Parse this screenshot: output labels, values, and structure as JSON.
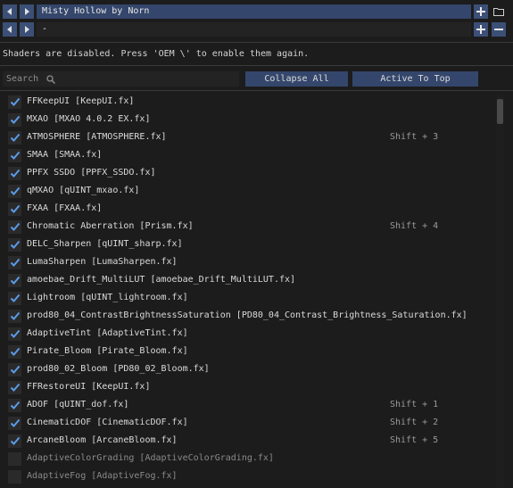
{
  "preset": {
    "name": "Misty Hollow by Norn"
  },
  "second": {
    "value": "-"
  },
  "message": "Shaders are disabled. Press 'OEM \\' to enable them again.",
  "search": {
    "placeholder": "Search"
  },
  "buttons": {
    "collapse": "Collapse All",
    "active_top": "Active To Top"
  },
  "icons": {
    "prev": "chevron-left-icon",
    "next": "chevron-right-icon",
    "add": "plus-icon",
    "folder": "folder-icon",
    "remove": "minus-icon",
    "search": "search-icon",
    "check": "checkmark-icon"
  },
  "colors": {
    "accent": "#3b4f77",
    "check": "#5b9be8",
    "background": "#1c1c1c"
  },
  "effects": [
    {
      "name": "FFKeepUI [KeepUI.fx]",
      "hotkey": "",
      "enabled": true
    },
    {
      "name": "MXAO [MXAO 4.0.2 EX.fx]",
      "hotkey": "",
      "enabled": true
    },
    {
      "name": "ATMOSPHERE [ATMOSPHERE.fx]",
      "hotkey": "Shift + 3",
      "enabled": true
    },
    {
      "name": "SMAA [SMAA.fx]",
      "hotkey": "",
      "enabled": true
    },
    {
      "name": "PPFX SSDO [PPFX_SSDO.fx]",
      "hotkey": "",
      "enabled": true
    },
    {
      "name": "qMXAO [qUINT_mxao.fx]",
      "hotkey": "",
      "enabled": true
    },
    {
      "name": "FXAA [FXAA.fx]",
      "hotkey": "",
      "enabled": true
    },
    {
      "name": "Chromatic Aberration [Prism.fx]",
      "hotkey": "Shift + 4",
      "enabled": true
    },
    {
      "name": "DELC_Sharpen [qUINT_sharp.fx]",
      "hotkey": "",
      "enabled": true
    },
    {
      "name": "LumaSharpen [LumaSharpen.fx]",
      "hotkey": "",
      "enabled": true
    },
    {
      "name": "amoebae_Drift_MultiLUT [amoebae_Drift_MultiLUT.fx]",
      "hotkey": "",
      "enabled": true
    },
    {
      "name": "Lightroom [qUINT_lightroom.fx]",
      "hotkey": "",
      "enabled": true
    },
    {
      "name": "prod80_04_ContrastBrightnessSaturation [PD80_04_Contrast_Brightness_Saturation.fx]",
      "hotkey": "",
      "enabled": true
    },
    {
      "name": "AdaptiveTint [AdaptiveTint.fx]",
      "hotkey": "",
      "enabled": true
    },
    {
      "name": "Pirate_Bloom [Pirate_Bloom.fx]",
      "hotkey": "",
      "enabled": true
    },
    {
      "name": "prod80_02_Bloom [PD80_02_Bloom.fx]",
      "hotkey": "",
      "enabled": true
    },
    {
      "name": "FFRestoreUI [KeepUI.fx]",
      "hotkey": "",
      "enabled": true
    },
    {
      "name": "ADOF [qUINT_dof.fx]",
      "hotkey": "Shift + 1",
      "enabled": true
    },
    {
      "name": "CinematicDOF [CinematicDOF.fx]",
      "hotkey": "Shift + 2",
      "enabled": true
    },
    {
      "name": "ArcaneBloom [ArcaneBloom.fx]",
      "hotkey": "Shift + 5",
      "enabled": true
    },
    {
      "name": "AdaptiveColorGrading [AdaptiveColorGrading.fx]",
      "hotkey": "",
      "enabled": false
    },
    {
      "name": "AdaptiveFog [AdaptiveFog.fx]",
      "hotkey": "",
      "enabled": false
    }
  ]
}
